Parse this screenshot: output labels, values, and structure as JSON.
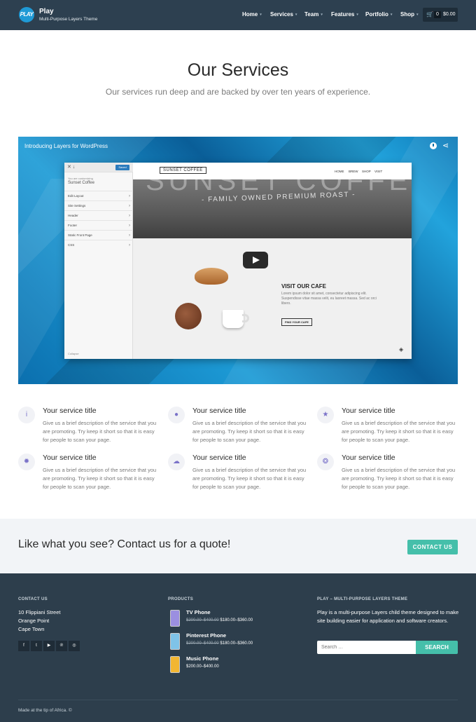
{
  "header": {
    "logo_text": "PLAY",
    "brand_title": "Play",
    "brand_tagline": "Multi-Purpose Layers Theme",
    "nav": [
      {
        "label": "Home"
      },
      {
        "label": "Services"
      },
      {
        "label": "Team"
      },
      {
        "label": "Features"
      },
      {
        "label": "Portfolio"
      },
      {
        "label": "Shop"
      }
    ],
    "cart": {
      "count": "0",
      "total": "$0.00"
    }
  },
  "hero": {
    "title": "Our Services",
    "subtitle": "Our services run deep and are backed by over ten years of experience."
  },
  "video": {
    "title": "Introducing Layers for WordPress",
    "panel": {
      "save": "Saved",
      "customizing": "You are customizing",
      "site_name": "Sunset Coffee",
      "items": [
        "Edit Layout",
        "Site Settings",
        "Header",
        "Footer",
        "Static Front Page",
        "CSS"
      ],
      "collapse": "Collapse"
    },
    "site": {
      "logo": "SUNSET COFFEE",
      "nav": [
        "HOME",
        "BREW",
        "SHOP",
        "VISIT"
      ],
      "hero_big": "SUNSET COFFEE",
      "hero_small": "- FAMILY OWNED PREMIUM ROAST -",
      "visit_title": "VISIT OUR CAFE",
      "visit_text": "Lorem ipsum dolor sit amet, consectetur adipiscing elit. Suspendisse vitae massa velit, eu laoreet massa. Sed ac orci libero.",
      "visit_button": "FIND YOUR CAFE"
    }
  },
  "services": [
    {
      "icon": "info-icon",
      "glyph": "i",
      "title": "Your service title",
      "desc": "Give us a brief description of the service that you are promoting. Try keep it short so that it is easy for people to scan your page."
    },
    {
      "icon": "piggy-bank-icon",
      "glyph": "●",
      "title": "Your service title",
      "desc": "Give us a brief description of the service that you are promoting. Try keep it short so that it is easy for people to scan your page."
    },
    {
      "icon": "star-icon",
      "glyph": "★",
      "title": "Your service title",
      "desc": "Give us a brief description of the service that you are promoting. Try keep it short so that it is easy for people to scan your page."
    },
    {
      "icon": "gear-icon",
      "glyph": "✹",
      "title": "Your service title",
      "desc": "Give us a brief description of the service that you are promoting. Try keep it short so that it is easy for people to scan your page."
    },
    {
      "icon": "cloud-icon",
      "glyph": "☁",
      "title": "Your service title",
      "desc": "Give us a brief description of the service that you are promoting. Try keep it short so that it is easy for people to scan your page."
    },
    {
      "icon": "support-icon",
      "glyph": "❂",
      "title": "Your service title",
      "desc": "Give us a brief description of the service that you are promoting. Try keep it short so that it is easy for people to scan your page."
    }
  ],
  "cta": {
    "text": "Like what you see? Contact us for a quote!",
    "button": "CONTACT US"
  },
  "footer": {
    "contact_heading": "CONTACT US",
    "address": [
      "10 Flippiani Street",
      "Orange Point",
      "Cape Town"
    ],
    "social": [
      "f",
      "t",
      "▶",
      "℗",
      "◎"
    ],
    "products_heading": "PRODUCTS",
    "products": [
      {
        "name": "TV Phone",
        "old": "$200.00–$400.00",
        "new": "$180.00–$360.00",
        "color": "#9b8fe0"
      },
      {
        "name": "Pinterest Phone",
        "old": "$200.00–$400.00",
        "new": "$180.00–$360.00",
        "color": "#7fc3e8"
      },
      {
        "name": "Music Phone",
        "old": "",
        "new": "$200.00–$400.00",
        "color": "#f2b632"
      }
    ],
    "about_heading": "PLAY – MULTI-PURPOSE LAYERS THEME",
    "about_text": "Play is a multi-purpose Layers child theme designed to make site building easier for application and software creators.",
    "search_placeholder": "Search …",
    "search_button": "SEARCH",
    "copyright": "Made at the tip of Africa. ©"
  }
}
